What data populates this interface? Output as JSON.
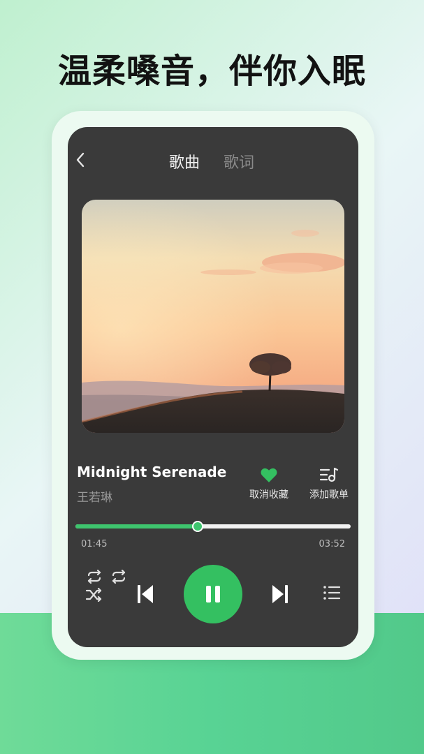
{
  "headline": "温柔嗓音，伴你入眠",
  "colors": {
    "accent": "#34c061",
    "screen_bg": "#3a3a3a"
  },
  "player": {
    "tabs": [
      {
        "label": "歌曲",
        "active": true
      },
      {
        "label": "歌词",
        "active": false
      }
    ],
    "song": {
      "title": "Midnight Serenade",
      "artist": "王若琳"
    },
    "actions": {
      "favorite": {
        "label": "取消收藏",
        "icon": "heart-icon"
      },
      "add_playlist": {
        "label": "添加歌单",
        "icon": "playlist-add-icon"
      }
    },
    "progress": {
      "current": "01:45",
      "total": "03:52",
      "fraction": 0.445
    },
    "controls": {
      "icons": [
        "repeat-icon",
        "repeat-one-icon",
        "shuffle-icon",
        "previous-icon",
        "pause-icon",
        "next-icon",
        "queue-list-icon"
      ],
      "is_playing": true
    }
  }
}
